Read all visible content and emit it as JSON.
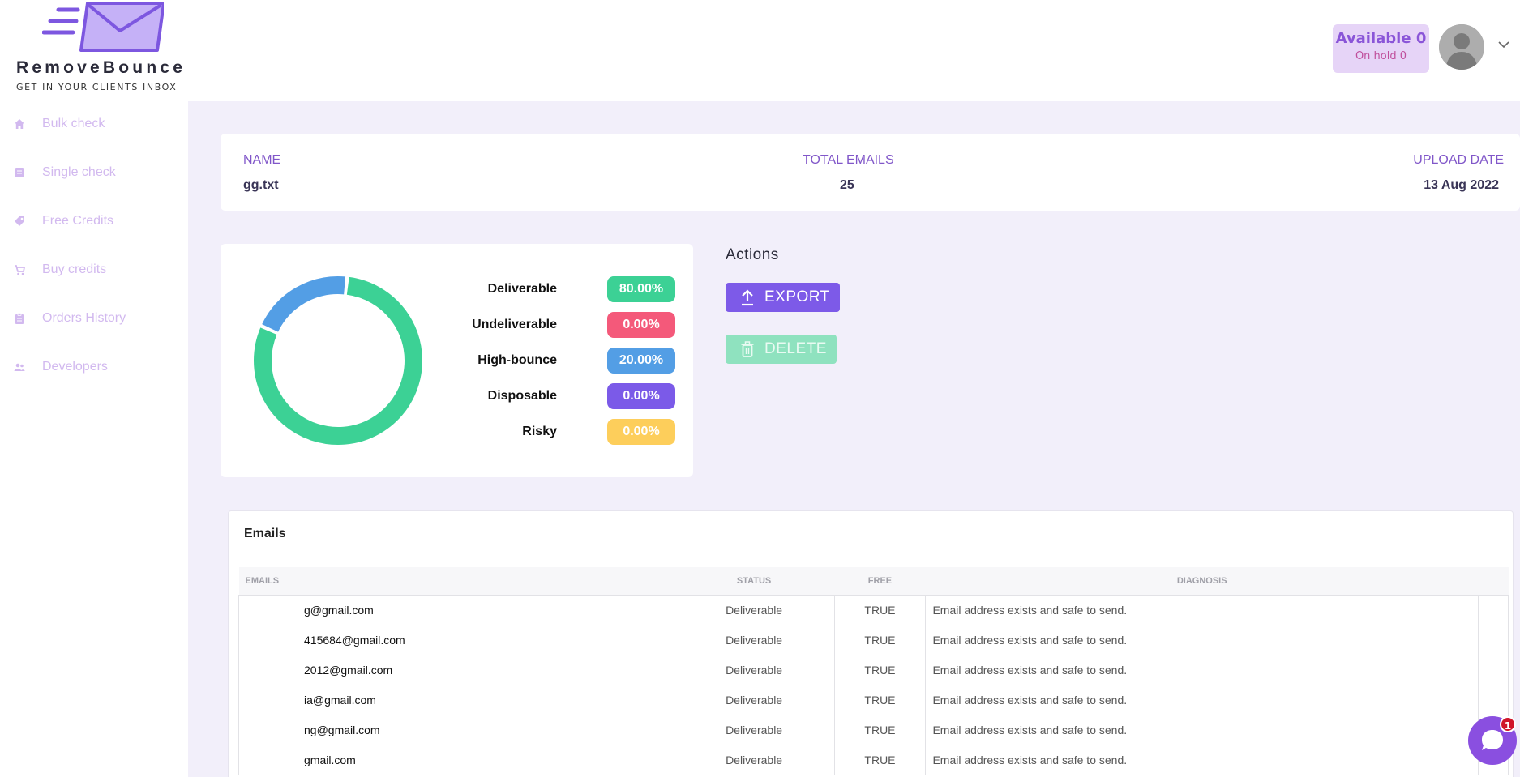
{
  "header": {
    "brand_name": "RemoveBounce",
    "brand_tagline": "GET IN YOUR CLIENTS INBOX",
    "available_label": "Available 0",
    "on_hold_label": "On hold 0"
  },
  "sidebar": {
    "items": [
      {
        "label": "Bulk check",
        "icon": "home-icon"
      },
      {
        "label": "Single check",
        "icon": "list-icon"
      },
      {
        "label": "Free Credits",
        "icon": "tag-icon"
      },
      {
        "label": "Buy credits",
        "icon": "cart-icon"
      },
      {
        "label": "Orders History",
        "icon": "clipboard-icon"
      },
      {
        "label": "Developers",
        "icon": "users-icon"
      }
    ]
  },
  "file_info": {
    "name_header": "NAME",
    "name_value": "gg.txt",
    "total_header": "TOTAL EMAILS",
    "total_value": "25",
    "date_header": "UPLOAD DATE",
    "date_value": "13 Aug 2022"
  },
  "chart_data": {
    "type": "pie",
    "categories": [
      "Deliverable",
      "Undeliverable",
      "High-bounce",
      "Disposable",
      "Risky"
    ],
    "values": [
      80.0,
      0.0,
      20.0,
      0.0,
      0.0
    ],
    "value_labels": [
      "80.00%",
      "0.00%",
      "20.00%",
      "0.00%",
      "0.00%"
    ],
    "colors": [
      "#3cd195",
      "#f4597a",
      "#539ee5",
      "#7b5ae8",
      "#fdce5b"
    ],
    "donut": true,
    "legend_position": "right"
  },
  "actions": {
    "title": "Actions",
    "export_label": "EXPORT",
    "delete_label": "DELETE"
  },
  "emails": {
    "title": "Emails",
    "columns": [
      "EMAILS",
      "STATUS",
      "FREE",
      "DIAGNOSIS"
    ],
    "rows": [
      {
        "email": "g@gmail.com",
        "status": "Deliverable",
        "free": "TRUE",
        "diagnosis": "Email address exists and safe to send."
      },
      {
        "email": "415684@gmail.com",
        "status": "Deliverable",
        "free": "TRUE",
        "diagnosis": "Email address exists and safe to send."
      },
      {
        "email": "2012@gmail.com",
        "status": "Deliverable",
        "free": "TRUE",
        "diagnosis": "Email address exists and safe to send."
      },
      {
        "email": "ia@gmail.com",
        "status": "Deliverable",
        "free": "TRUE",
        "diagnosis": "Email address exists and safe to send."
      },
      {
        "email": "ng@gmail.com",
        "status": "Deliverable",
        "free": "TRUE",
        "diagnosis": "Email address exists and safe to send."
      },
      {
        "email": "gmail.com",
        "status": "Deliverable",
        "free": "TRUE",
        "diagnosis": "Email address exists and safe to send."
      }
    ]
  },
  "chat": {
    "badge_count": "1"
  }
}
